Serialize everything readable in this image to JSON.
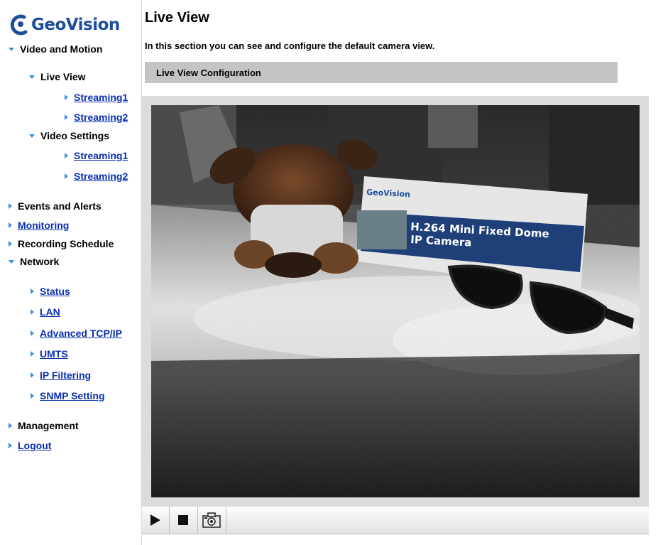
{
  "brand": {
    "name": "GeoVision",
    "color": "#1d4e9c"
  },
  "sidebar": {
    "video_and_motion": "Video and Motion",
    "live_view": "Live View",
    "live_streaming1": "Streaming1",
    "live_streaming2": "Streaming2",
    "video_settings": "Video Settings",
    "vs_streaming1": "Streaming1",
    "vs_streaming2": "Streaming2",
    "events_and_alerts": "Events and Alerts",
    "monitoring": "Monitoring",
    "recording_schedule": "Recording Schedule",
    "network": "Network",
    "status": "Status",
    "lan": "LAN",
    "advanced_tcpip": "Advanced TCP/IP",
    "umts": "UMTS",
    "ip_filtering": "IP Filtering",
    "snmp_setting": "SNMP Setting",
    "management": "Management",
    "logout": "Logout"
  },
  "main": {
    "title": "Live View",
    "intro": "In this section you can see and configure the default camera view.",
    "section_header": "Live View Configuration"
  },
  "video": {
    "box_brand": "GeoVision",
    "box_line1": "H.264 Mini Fixed Dome",
    "box_line2": "IP Camera"
  },
  "controls": {
    "play": "play-icon",
    "stop": "stop-icon",
    "snapshot": "camera-icon"
  },
  "colors": {
    "link": "#0b2fb0",
    "arrow": "#3a8ee6",
    "section_bar": "#c4c4c4"
  }
}
